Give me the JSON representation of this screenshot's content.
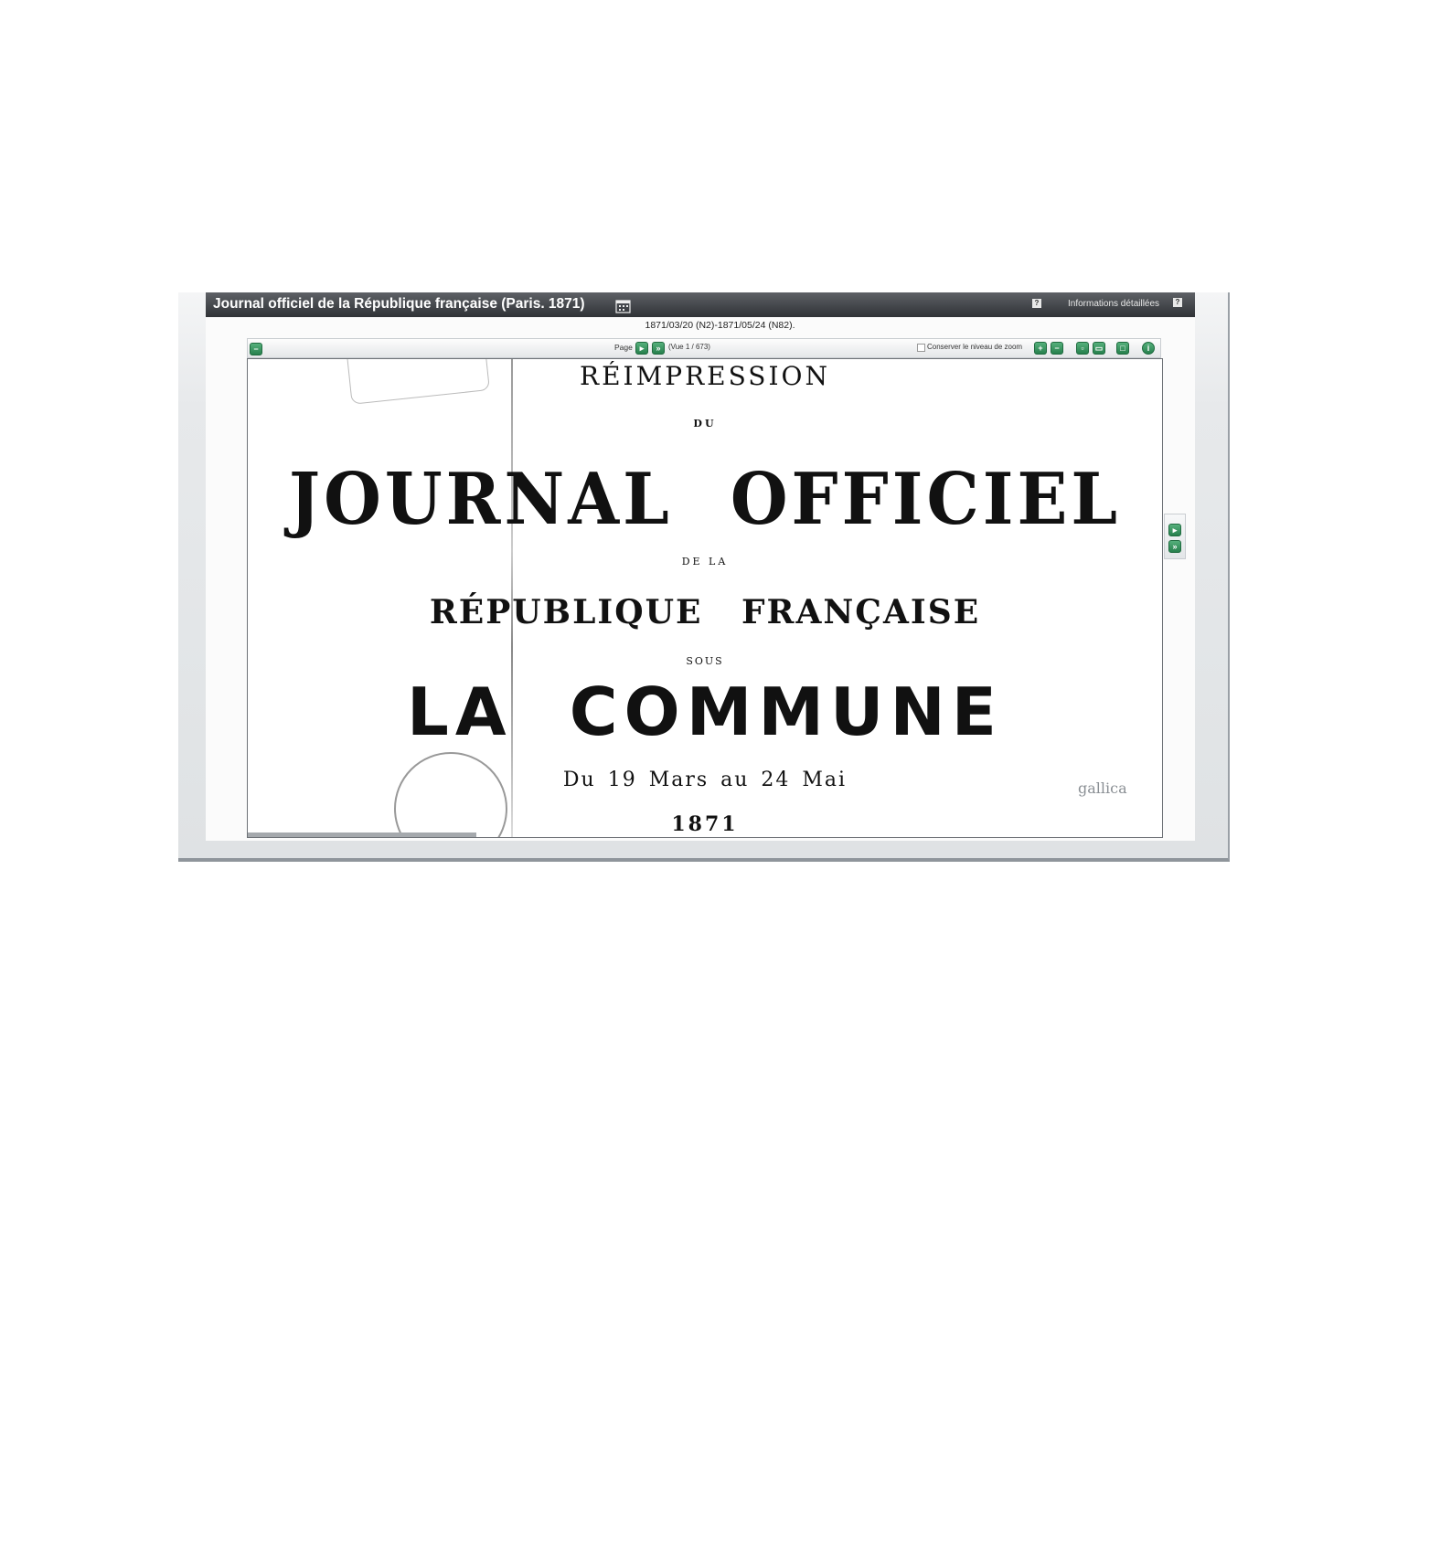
{
  "window": {
    "title": "Journal officiel de la République française (Paris. 1871)",
    "help_icon": "question-icon",
    "detailed_info_label": "Informations détaillées"
  },
  "document": {
    "date_range": "1871/03/20 (N2)-1871/05/24 (N82)."
  },
  "toolbar": {
    "page_label": "Page",
    "view_counter": "(Vue 1 / 673)",
    "keep_zoom_label": "Conserver le niveau de zoom",
    "keep_zoom_checked": false,
    "accent_color": "#2e8b57"
  },
  "page_content": {
    "line1": "RÉIMPRESSION",
    "line2": "DU",
    "line3": "JOURNAL OFFICIEL",
    "line4": "DE LA",
    "line5": "RÉPUBLIQUE FRANÇAISE",
    "line6": "SOUS",
    "line7": "LA COMMUNE",
    "line8": "Du 19 Mars au 24 Mai",
    "line9": "1871",
    "watermark": "gallica"
  }
}
